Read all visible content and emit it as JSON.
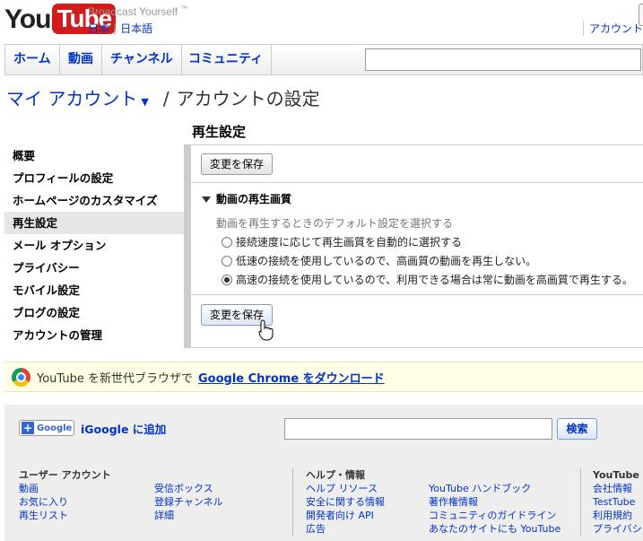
{
  "header": {
    "logo_you": "You",
    "logo_tube": "Tube",
    "tagline": "Broadcast Yourself",
    "tagline_tm": "™",
    "country": "日本",
    "language": "日本語",
    "account_link": "アカウント"
  },
  "nav": {
    "tabs": [
      "ホーム",
      "動画",
      "チャンネル",
      "コミュニティ"
    ],
    "search_value": ""
  },
  "breadcrumb": {
    "my_account": "マイ アカウント",
    "separator": "/",
    "current": "アカウントの設定"
  },
  "section_title": "再生設定",
  "sidebar": {
    "items": [
      "概要",
      "プロフィールの設定",
      "ホームページのカスタマイズ",
      "再生設定",
      "メール オプション",
      "プライバシー",
      "モバイル設定",
      "ブログの設定",
      "アカウントの管理"
    ],
    "active_index": 3
  },
  "settings": {
    "save_label_top": "変更を保存",
    "save_label_bottom": "変更を保存",
    "group_title": "動画の再生画質",
    "group_desc": "動画を再生するときのデフォルト設定を選択する",
    "options": [
      {
        "label": "接続速度に応じて再生画質を自動的に選択する",
        "checked": false
      },
      {
        "label": "低速の接続を使用しているので、高画質の動画を再生しない。",
        "checked": false
      },
      {
        "label": "高速の接続を使用しているので、利用できる場合は常に動画を高画質で再生する。",
        "checked": true
      }
    ]
  },
  "promo": {
    "text": "YouTube を新世代ブラウザで",
    "link": "Google Chrome をダウンロード"
  },
  "footer": {
    "igoogle_button": "Google",
    "igoogle_label": "iGoogle に追加",
    "search_value": "",
    "search_button": "検索",
    "col1_head": "ユーザー アカウント",
    "col1_links": [
      "動画",
      "お気に入り",
      "再生リスト"
    ],
    "col2_links": [
      "受信ボックス",
      "登録チャンネル",
      "詳細"
    ],
    "col3_head": "ヘルプ・情報",
    "col3_links": [
      "ヘルプ リソース",
      "安全に関する情報",
      "開発者向け API",
      "広告"
    ],
    "col4_links": [
      "YouTube ハンドブック",
      "著作権情報",
      "コミュニティのガイドライン",
      "あなたのサイトにも YouTube"
    ],
    "col5_head": "YouTube",
    "col5_links": [
      "会社情報",
      "TestTube",
      "利用規約",
      "プライバシー"
    ]
  }
}
